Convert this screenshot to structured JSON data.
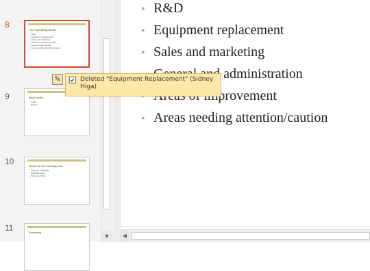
{
  "thumbnails": [
    {
      "number": "8",
      "title": "Our Spending Areas",
      "lines": "- R&D\n- Equipment replacement\n- Sales and marketing\n- General and administration\n- Areas of improvement\n- Areas needing attention/caution",
      "selected": true
    },
    {
      "number": "9",
      "title": "Next Goals",
      "lines": "- Goals\n- Results",
      "selected": false
    },
    {
      "number": "10",
      "title": "Goals for the Coming Year",
      "lines": "- Testing & marketing\n- Financial goals\n- Other key efforts",
      "selected": false
    },
    {
      "number": "11",
      "title": "Summary",
      "lines": "",
      "selected": false
    }
  ],
  "slide": {
    "bullets": [
      "R&D",
      "Equipment replacement",
      "Sales and marketing",
      "General and administration",
      "Areas of improvement",
      "Areas needing attention/caution"
    ]
  },
  "comment_tooltip": {
    "text": "Deleted \"Equipment Replacement\" (Sidney Higa)",
    "checked": true
  },
  "icons": {
    "checkbox": "checkbox-checked-icon",
    "revision_marker": "revision-marker-icon",
    "scroll_down": "chevron-down-icon",
    "scroll_left": "chevron-left-icon"
  },
  "colors": {
    "selected_border": "#d24726",
    "tooltip_bg": "#fde8a8",
    "bullet": "#7ea7cf"
  }
}
